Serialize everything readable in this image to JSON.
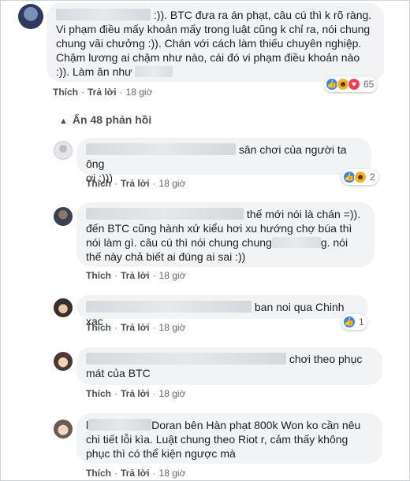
{
  "comment_main": {
    "text_1": ":)). BTC đưa ra án phạt, câu cú thì k rõ ràng.",
    "text_2": "Vi phạm điều mấy khoản mấy trong luật cũng k chỉ ra, nói chung",
    "text_3": "chung vãi chưởng :)). Chán với cách làm thiếu chuyên nghiệp.",
    "text_4": "Chậm lương ai chậm như nào, cái đó vi phạm điều khoản nào",
    "text_5": ":)). Làm ăn như",
    "like": "Thích",
    "reply": "Trả lời",
    "time": "18 giờ",
    "reactions_count": "65"
  },
  "replies_toggle": {
    "label": "Ẩn 48 phản hồi",
    "icon": "chevron-up-icon"
  },
  "replies": [
    {
      "text_1": "sân chơi của người ta ông",
      "text_2": "ơi :)))",
      "like": "Thích",
      "reply": "Trả lời",
      "time": "18 giờ",
      "reactions_count": "2"
    },
    {
      "text_1": "thế mới nói là chán =)).",
      "text_2": "đến BTC cũng hành xử kiểu hơi xu hướng chợ búa thì",
      "text_3": "nói làm gì. câu cú thì nói chung chung",
      "text_3b": "g. nói",
      "text_4": "thế này chả biết ai đúng ai sai :))",
      "like": "Thích",
      "reply": "Trả lời",
      "time": "18 giờ"
    },
    {
      "text_1": "ban noi qua Chinh xac",
      "like": "Thích",
      "reply": "Trả lời",
      "time": "18 giờ",
      "reactions_count": "1"
    },
    {
      "text_1": "chơi theo phục",
      "text_2": "mát của BTC",
      "like": "Thích",
      "reply": "Trả lời",
      "time": "18 giờ"
    },
    {
      "text_1_prefix": "l",
      "text_1": "Doran bên Hàn phạt 800k Won ko cần nêu",
      "text_2": "chi tiết lỗi kìa. Luật chung theo Riot r, cảm thấy không",
      "text_3": "phục thì có thể kiện ngược mà",
      "like": "Thích",
      "reply": "Trả lời",
      "time": "18 giờ"
    }
  ],
  "colors": {
    "bubble_bg": "#f2f3f5",
    "like_blue": "#2d88ff",
    "haha_yellow": "#f7b125",
    "love_red": "#f33e58"
  }
}
